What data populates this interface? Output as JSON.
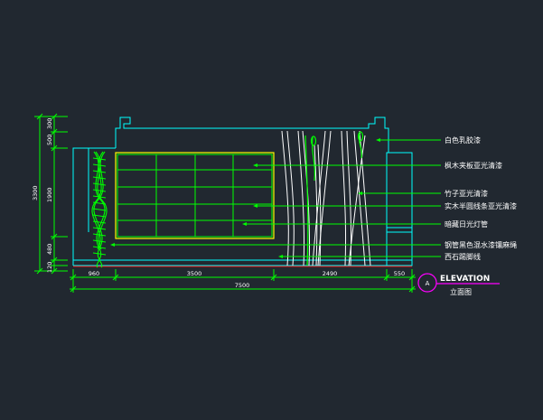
{
  "colors": {
    "background": "#212830",
    "cyan": "#00ffff",
    "green": "#00ff00",
    "white": "#ffffff",
    "red": "#ff0000",
    "magenta": "#ff00ff"
  },
  "annotations": [
    "白色乳胶漆",
    "枫木夹板亚光清漆",
    "竹子亚光清漆",
    "实木半圆线条亚光清漆",
    "暗藏日光灯管",
    "钢管黑色混水漆镶麻绳",
    "西石踢脚线"
  ],
  "vertical_dims": {
    "total": "3300",
    "segments": [
      "300",
      "500",
      "1900",
      "480",
      "120"
    ]
  },
  "horizontal_dims": {
    "segments": [
      "960",
      "3500",
      "2490",
      "550"
    ],
    "total": "7500"
  },
  "title": {
    "marker": "A",
    "label": "ELEVATION",
    "sublabel": "立面图"
  }
}
